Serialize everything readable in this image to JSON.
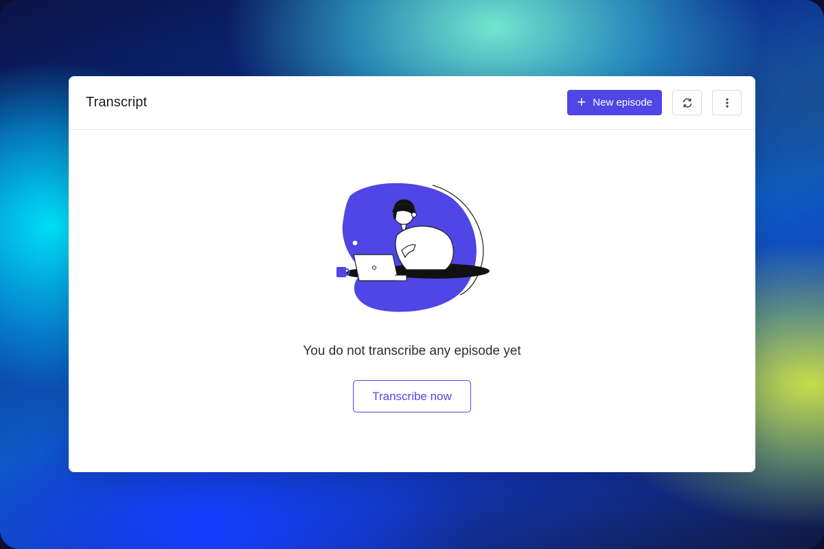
{
  "header": {
    "title": "Transcript",
    "new_episode_label": "New episode",
    "refresh_icon": "refresh-icon",
    "more_icon": "more-vertical-icon"
  },
  "empty_state": {
    "message": "You do not transcribe any episode yet",
    "cta_label": "Transcribe now"
  },
  "colors": {
    "accent": "#4f46e5",
    "card_bg": "#ffffff",
    "border": "#e6e7eb",
    "text": "#1b1d26"
  }
}
